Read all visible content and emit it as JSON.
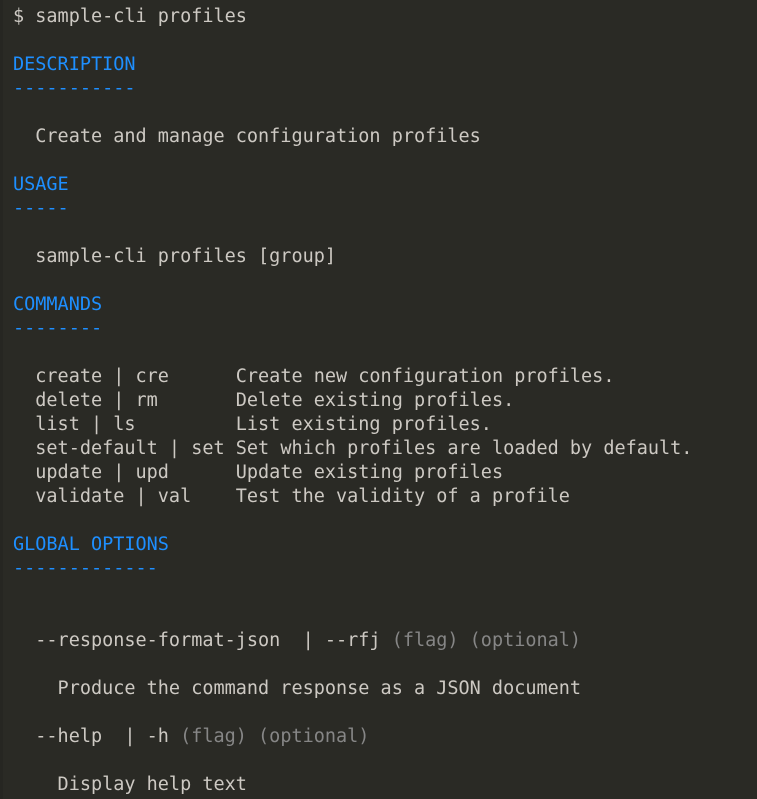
{
  "terminal": {
    "background_color": "#2a2a25",
    "text_color": "#cdc9c3",
    "heading_color": "#1e8fff",
    "dim_color": "#868686",
    "prompt_line": "$ sample-cli profiles",
    "prompt_symbol": "$",
    "command_typed": "sample-cli profiles"
  },
  "sections": {
    "description": {
      "heading": "DESCRIPTION",
      "rule": "-----------",
      "body": "  Create and manage configuration profiles"
    },
    "usage": {
      "heading": "USAGE",
      "rule": "-----",
      "body": "  sample-cli profiles [group]"
    },
    "commands": {
      "heading": "COMMANDS",
      "rule": "--------",
      "rows": [
        {
          "name": "create | cre",
          "padded": "  create | cre      ",
          "description": "Create new configuration profiles."
        },
        {
          "name": "delete | rm",
          "padded": "  delete | rm       ",
          "description": "Delete existing profiles."
        },
        {
          "name": "list | ls",
          "padded": "  list | ls         ",
          "description": "List existing profiles."
        },
        {
          "name": "set-default | set",
          "padded": "  set-default | set ",
          "description": "Set which profiles are loaded by default."
        },
        {
          "name": "update | upd",
          "padded": "  update | upd      ",
          "description": "Update existing profiles"
        },
        {
          "name": "validate | val",
          "padded": "  validate | val    ",
          "description": "Test the validity of a profile"
        }
      ]
    },
    "global_options": {
      "heading": "GLOBAL OPTIONS",
      "rule": "-------------",
      "options": [
        {
          "flag_line_indent": "  ",
          "flag": "--response-format-json  | --rfj",
          "type": "(flag)",
          "requirement": "(optional)",
          "description": "    Produce the command response as a JSON document"
        },
        {
          "flag_line_indent": "  ",
          "flag": "--help  | -h",
          "type": "(flag)",
          "requirement": "(optional)",
          "description": "    Display help text"
        }
      ]
    }
  }
}
